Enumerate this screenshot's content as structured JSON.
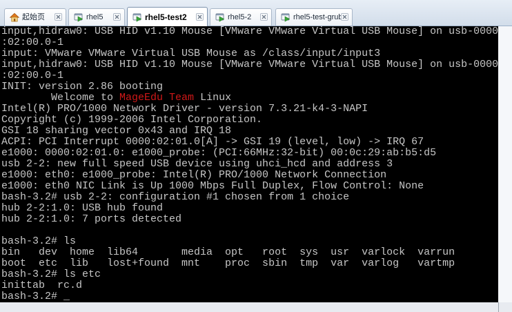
{
  "tabs": [
    {
      "label": "起始页",
      "icon": "home-icon",
      "active": false
    },
    {
      "label": "rhel5",
      "icon": "vm-icon",
      "active": false
    },
    {
      "label": "rhel5-test2",
      "icon": "vm-icon",
      "active": true
    },
    {
      "label": "rhel5-2",
      "icon": "vm-icon",
      "active": false
    },
    {
      "label": "rhel5-test-grub",
      "icon": "vm-icon",
      "active": false
    }
  ],
  "tab_close_icon": "close-icon",
  "colors": {
    "terminal_background": "#000000",
    "terminal_text": "#c6c6c6",
    "terminal_highlight": "#d01818",
    "active_tab_border": "#7d92ad"
  },
  "terminal": {
    "lines": [
      "input,hidraw0: USB HID v1.10 Mouse [VMware VMware Virtual USB Mouse] on usb-0000",
      ":02:00.0-1",
      "input: VMware VMware Virtual USB Mouse as /class/input/input3",
      "input,hidraw0: USB HID v1.10 Mouse [VMware VMware Virtual USB Mouse] on usb-0000",
      ":02:00.0-1",
      "INIT: version 2.86 booting",
      {
        "prefix": "        Welcome to ",
        "highlight": "MageEdu Team",
        "suffix": " Linux"
      },
      "Intel(R) PRO/1000 Network Driver - version 7.3.21-k4-3-NAPI",
      "Copyright (c) 1999-2006 Intel Corporation.",
      "GSI 18 sharing vector 0x43 and IRQ 18",
      "ACPI: PCI Interrupt 0000:02:01.0[A] -> GSI 19 (level, low) -> IRQ 67",
      "e1000: 0000:02:01.0: e1000_probe: (PCI:66MHz:32-bit) 00:0c:29:ab:b5:d5",
      "usb 2-2: new full speed USB device using uhci_hcd and address 3",
      "e1000: eth0: e1000_probe: Intel(R) PRO/1000 Network Connection",
      "e1000: eth0 NIC Link is Up 1000 Mbps Full Duplex, Flow Control: None",
      "bash-3.2# usb 2-2: configuration #1 chosen from 1 choice",
      "hub 2-2:1.0: USB hub found",
      "hub 2-2:1.0: 7 ports detected",
      "",
      "bash-3.2# ls",
      "bin   dev  home  lib64       media  opt   root  sys  usr  varlock  varrun",
      "boot  etc  lib   lost+found  mnt    proc  sbin  tmp  var  varlog   vartmp",
      "bash-3.2# ls etc",
      "inittab  rc.d",
      {
        "prompt": "bash-3.2# ",
        "cursor": "_"
      }
    ]
  }
}
